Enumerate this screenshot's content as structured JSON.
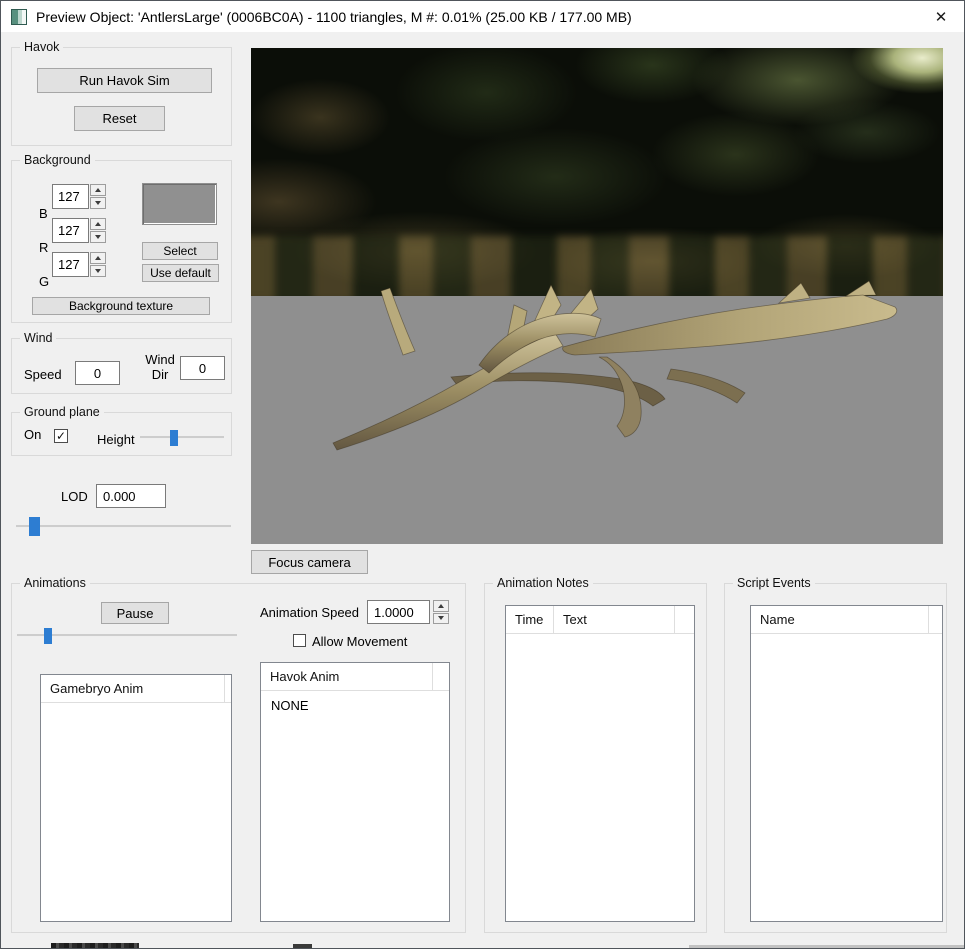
{
  "window": {
    "title": "Preview Object: 'AntlersLarge' (0006BC0A) - 1100 triangles, M #: 0.01% (25.00 KB / 177.00 MB)",
    "close_glyph": "✕"
  },
  "colors": {
    "swatch": "#909090",
    "slider_thumb": "#2d7dd2",
    "viewport_ground": "#8f8f8f"
  },
  "havok": {
    "group_label": "Havok",
    "run_sim_button": "Run Havok Sim",
    "reset_button": "Reset"
  },
  "background": {
    "group_label": "Background",
    "channels": [
      {
        "label": "B",
        "value": "127"
      },
      {
        "label": "R",
        "value": "127"
      },
      {
        "label": "G",
        "value": "127"
      }
    ],
    "select_button": "Select",
    "use_default_button": "Use default",
    "texture_button": "Background texture"
  },
  "wind": {
    "group_label": "Wind",
    "speed_label": "Speed",
    "speed_value": "0",
    "dir_label_line1": "Wind",
    "dir_label_line2": "Dir",
    "dir_value": "0"
  },
  "ground_plane": {
    "group_label": "Ground plane",
    "on_label": "On",
    "on_checked": true,
    "check_glyph": "✓",
    "height_label": "Height"
  },
  "lod": {
    "label": "LOD",
    "value": "0.000"
  },
  "viewport": {
    "focus_camera_button": "Focus camera"
  },
  "animations": {
    "group_label": "Animations",
    "pause_button": "Pause",
    "speed_label": "Animation Speed",
    "speed_value": "1.0000",
    "allow_movement_label": "Allow Movement",
    "allow_movement_checked": false,
    "gamebryo_list": {
      "header": "Gamebryo Anim",
      "items": []
    },
    "havok_list": {
      "header": "Havok Anim",
      "items": [
        "NONE"
      ]
    }
  },
  "animation_notes": {
    "group_label": "Animation Notes",
    "columns": [
      "Time",
      "Text"
    ],
    "rows": []
  },
  "script_events": {
    "group_label": "Script Events",
    "columns": [
      "Name"
    ],
    "rows": []
  }
}
